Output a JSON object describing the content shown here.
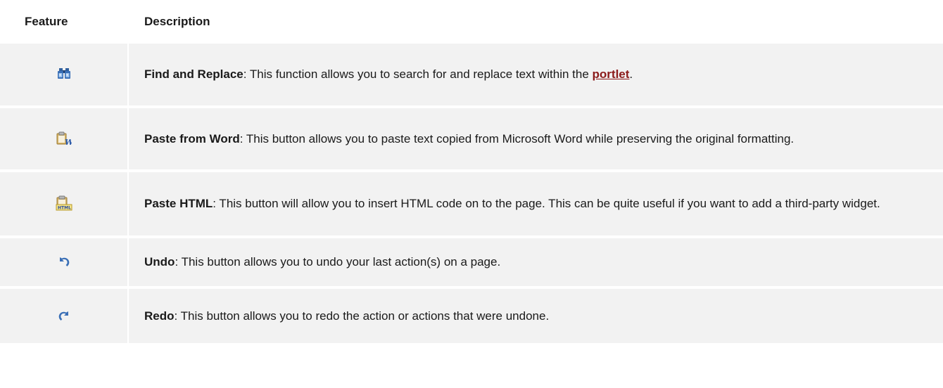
{
  "header": {
    "feature": "Feature",
    "description": "Description"
  },
  "rows": [
    {
      "icon": "binoculars-icon",
      "title": "Find and Replace",
      "text_before_link": ": This function allows you to search for and replace text within the ",
      "link": "portlet",
      "text_after_link": "."
    },
    {
      "icon": "paste-word-icon",
      "title": "Paste from Word",
      "text": ": This button allows you to paste text copied from Microsoft Word while preserving the original formatting."
    },
    {
      "icon": "paste-html-icon",
      "title": "Paste HTML",
      "text": ": This button will allow you to insert HTML code on to the page. This can be quite useful if you want to add a third-party widget."
    },
    {
      "icon": "undo-icon",
      "title": "Undo",
      "text": ": This button allows you to undo your last action(s) on a page."
    },
    {
      "icon": "redo-icon",
      "title": "Redo",
      "text": ": This button allows you to redo the action or actions that were undone."
    }
  ],
  "colors": {
    "row_background": "#f2f2f2",
    "link": "#8b1a1a",
    "icon_blue": "#3a6fb6"
  }
}
